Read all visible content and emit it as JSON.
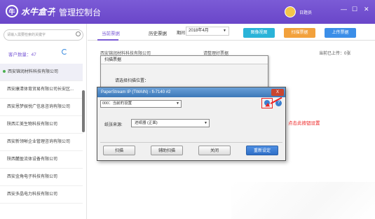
{
  "header": {
    "logo_mark": "牛",
    "logo_text": "水牛盒子",
    "title": "管理控制台",
    "user_name": "日题员",
    "win_min": "—",
    "win_max": "☐",
    "win_close": "✕"
  },
  "sidebar": {
    "search_placeholder": "请输入需要检索的关键字",
    "count_label": "客户数量：47",
    "items": [
      {
        "label": "西安锦润材料科技有限公司"
      },
      {
        "label": "西安康清体育贸易有限公司长安区..."
      },
      {
        "label": "西安恩梦娱悦广信息咨询有限公司"
      },
      {
        "label": "陕西汇美生物科技有限公司"
      },
      {
        "label": "西安新领晰企业管理咨询有限公司"
      },
      {
        "label": "陕西麓盈流体设备有限公司"
      },
      {
        "label": "西安金角电子科技有限公司"
      },
      {
        "label": "西安多晶电力科技有限公司"
      }
    ]
  },
  "main": {
    "tabs": [
      {
        "label": "当前票据"
      },
      {
        "label": "历史票据"
      }
    ],
    "date_label": "期间",
    "date_value": "2018年4月",
    "buttons": {
      "image_view": "图像视图",
      "scan": "扫描票据",
      "upload": "上传票据"
    },
    "row_company": "西安锦润材料科技有限公司",
    "row_status": "请整理好票据",
    "row_uploaded": "当前已上传：0张"
  },
  "dialog_scan": {
    "title": "扫描票据",
    "text": "请选择扫描位置："
  },
  "dialog_twain": {
    "title": "PaperStream IP (TWAIN) - fi-7140 #2",
    "close": "X",
    "scanner_value": "000：当前的设置",
    "help": "?",
    "source_label": "纸张来源:",
    "source_value": "进纸器 (正面)",
    "buttons": {
      "scan": "扫描",
      "assist_scan": "辅助扫描",
      "close": "关闭",
      "reset": "重新设定"
    }
  },
  "annotation": "点击此按钮设置",
  "colors": {
    "brand": "#7b5bd6",
    "image_view": "#2ab3d8",
    "scan": "#f2a13c",
    "upload": "#3b8ee8",
    "annotation": "#e22222"
  }
}
